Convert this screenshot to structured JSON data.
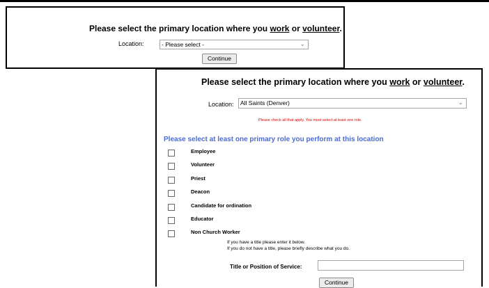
{
  "form1": {
    "heading_prefix": "Please select the primary location where you ",
    "heading_work": "work",
    "heading_or": " or ",
    "heading_volunteer": "volunteer",
    "heading_suffix": ".",
    "location_label": "Location:",
    "location_value": "- Please select -",
    "continue_label": "Continue"
  },
  "form2": {
    "heading_prefix": "Please select the primary location where you ",
    "heading_work": "work",
    "heading_or": " or ",
    "heading_volunteer": "volunteer",
    "heading_suffix": ".",
    "location_label": "Location:",
    "location_value": "All Saints (Denver)",
    "error_text": "Please check all that apply. You must select at least one role.",
    "roles_heading": "Please select at least one primary role you perform at this location",
    "roles": [
      {
        "label": "Employee",
        "checked": false
      },
      {
        "label": "Volunteer",
        "checked": false
      },
      {
        "label": "Priest",
        "checked": false
      },
      {
        "label": "Deacon",
        "checked": false
      },
      {
        "label": "Candidate for ordination",
        "checked": false
      },
      {
        "label": "Educator",
        "checked": false
      },
      {
        "label": "Non Church Worker",
        "checked": false
      }
    ],
    "title_note_line1": "If you have a title please enter it below.",
    "title_note_line2": "If you do not have a title, please briefly describe what you do.",
    "title_label": "Title or Position of Service:",
    "title_value": "",
    "continue_label": "Continue"
  },
  "colors": {
    "error": "#e00000",
    "roles_heading": "#4a6cd4"
  },
  "icons": {
    "dropdown": "chevron-down-icon"
  }
}
